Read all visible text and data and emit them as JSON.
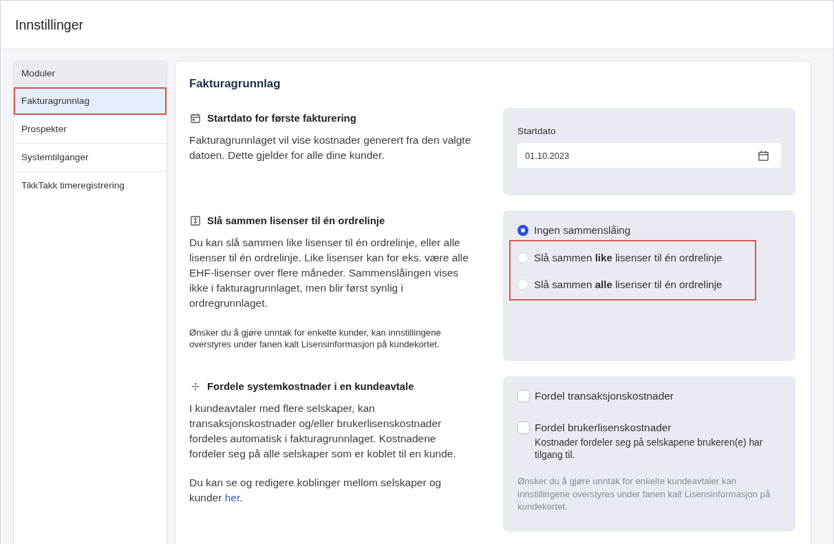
{
  "header": {
    "title": "Innstillinger"
  },
  "sidebar": {
    "heading": "Moduler",
    "items": [
      {
        "label": "Fakturagrunnlag",
        "selected": true,
        "highlighted": true
      },
      {
        "label": "Prospekter",
        "selected": false,
        "highlighted": false
      },
      {
        "label": "Systemtilganger",
        "selected": false,
        "highlighted": false
      },
      {
        "label": "TikkTakk timeregistrering",
        "selected": false,
        "highlighted": false
      }
    ]
  },
  "content": {
    "title": "Fakturagrunnlag",
    "sections": [
      {
        "kind": "date",
        "heading": "Startdato for første fakturering",
        "paragraphs": [
          {
            "text": "Fakturagrunnlaget vil vise kostnader generert fra den valgte datoen. Dette gjelder for alle dine kunder."
          }
        ],
        "panel": {
          "label": "Startdato",
          "value": "01.10.2023"
        }
      },
      {
        "kind": "radio",
        "heading": "Slå sammen lisenser til én ordrelinje",
        "paragraphs": [
          {
            "text": "Du kan slå sammen like lisenser til én ordrelinje, eller alle lisenser til én ordrelinje. Like lisenser kan for eks. være alle EHF-lisenser over flere måneder. Sammenslåingen vises ikke i fakturagrunnlaget, men blir først synlig i ordregrunnlaget."
          }
        ],
        "footnote": "Ønsker du å gjøre unntak for enkelte kunder, kan innstillingene overstyres under fanen kalt Lisensinformasjon på kundekortet.",
        "panel": {
          "options": [
            {
              "label": "Ingen sammenslåing",
              "selected": true,
              "highlighted": false
            },
            {
              "label": "Slå sammen **like** lisenser til én ordrelinje",
              "selected": false,
              "highlighted": true
            },
            {
              "label": "Slå sammen **alle** lisenser til én ordrelinje",
              "selected": false,
              "highlighted": true
            }
          ]
        }
      },
      {
        "kind": "checkbox",
        "heading": "Fordele systemkostnader i en kundeavtale",
        "paragraphs": [
          {
            "text": "I kundeavtaler med flere selskaper, kan transaksjonskostnader og/eller brukerlisenskostnader fordeles automatisk i fakturagrunnlaget. Kostnadene fordeler seg på alle selskaper som er koblet til en kunde."
          },
          {
            "text": "Du kan se og redigere koblinger mellom selskaper og kunder",
            "link": "her",
            "text_after": "."
          }
        ],
        "panel": {
          "options": [
            {
              "label": "Fordel transaksjonskostnader",
              "checked": false
            },
            {
              "label": "Fordel brukerlisenskostnader",
              "checked": false,
              "hint": "Kostnader fordeler seg på selskapene brukeren(e) har tilgang til."
            }
          ],
          "note": "Ønsker du å gjøre unntak for enkelte kundeavtaler kan innstillingene overstyres under fanen kalt Lisensinformasjon på kundekortet."
        }
      }
    ]
  }
}
